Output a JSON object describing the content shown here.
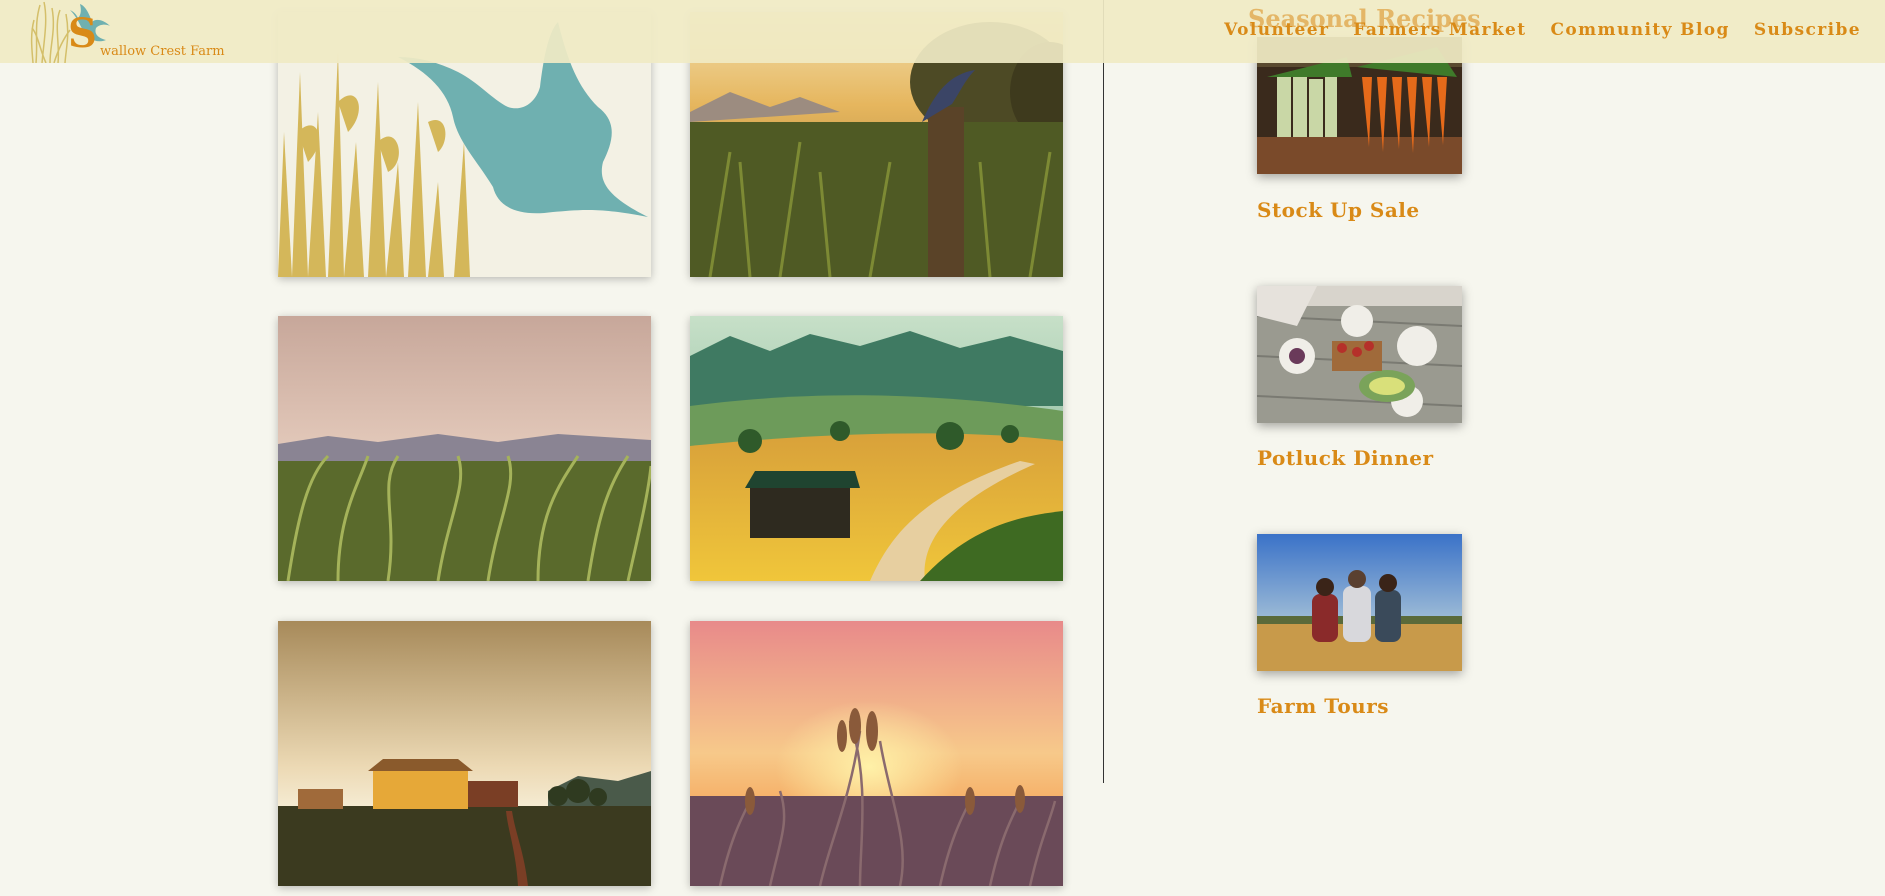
{
  "brand": {
    "name": "wallow Crest Farm",
    "initial": "S",
    "accent": "#d98a17",
    "bird_color": "#6fb0b0"
  },
  "nav": {
    "items": [
      "Volunteer",
      "Farmers Market",
      "Community Blog",
      "Subscribe"
    ]
  },
  "overlap_heading": "Seasonal Recipes",
  "gallery": {
    "tiles": [
      {
        "icon": "swallow-logo-image"
      },
      {
        "icon": "bird-on-fence-post-photo"
      },
      {
        "icon": "cornfield-photo"
      },
      {
        "icon": "barn-valley-road-photo"
      },
      {
        "icon": "farm-buildings-sunset-photo"
      },
      {
        "icon": "wheat-sunset-photo"
      }
    ]
  },
  "sidebar": {
    "items": [
      {
        "title": "Stock Up Sale",
        "icon": "vegetables-photo"
      },
      {
        "title": "Potluck Dinner",
        "icon": "dinner-table-photo"
      },
      {
        "title": "Farm Tours",
        "icon": "people-in-field-photo"
      }
    ]
  }
}
